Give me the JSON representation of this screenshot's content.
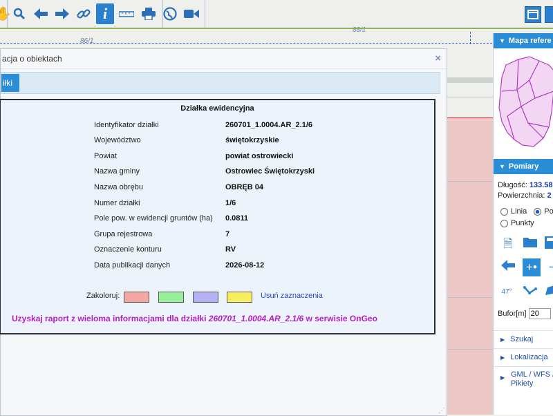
{
  "map": {
    "labels": [
      "86/1",
      "88/1"
    ]
  },
  "toolbar": {
    "icons": [
      "pan-icon",
      "zoom-icon",
      "back-icon",
      "forward-icon",
      "link-icon",
      "info-icon",
      "measure-icon",
      "print-icon",
      "globe-icon",
      "camera-icon"
    ],
    "info_glyph": "i"
  },
  "dialog": {
    "title": "acja o obiektach",
    "close": "×",
    "tab_label": "iłki",
    "heading": "Działka ewidencyjna",
    "rows": [
      {
        "label": "Identyfikator działki",
        "value": "260701_1.0004.AR_2.1/6"
      },
      {
        "label": "Województwo",
        "value": "świętokrzyskie"
      },
      {
        "label": "Powiat",
        "value": "powiat ostrowiecki"
      },
      {
        "label": "Nazwa gminy",
        "value": "Ostrowiec Świętokrzyski"
      },
      {
        "label": "Nazwa obrębu",
        "value": "OBRĘB 04"
      },
      {
        "label": "Numer działki",
        "value": "1/6"
      },
      {
        "label": "Pole pow. w ewidencji gruntów (ha)",
        "value": "0.0811"
      },
      {
        "label": "Grupa rejestrowa",
        "value": "7"
      },
      {
        "label": "Oznaczenie konturu",
        "value": "RV"
      },
      {
        "label": "Data publikacji danych",
        "value": "2026-08-12"
      }
    ],
    "colorize_label": "Zakoloruj:",
    "swatches": [
      "#f4a8a4",
      "#98f09a",
      "#b7b0f4",
      "#f6ee5c"
    ],
    "clear_link": "Usuń zaznaczenia",
    "report_prefix": "Uzyskaj raport z wieloma informacjami dla działki ",
    "report_id": "260701_1.0004.AR_2.1/6",
    "report_suffix": " w serwisie OnGeo"
  },
  "panel": {
    "refmap_title": "Mapa refere",
    "measure_title": "Pomiary",
    "length_label": "Długość: ",
    "length_value": "133.58",
    "area_label": "Powierzchnia: ",
    "area_value": "2",
    "radio_line": "Linia",
    "radio_polygon": "Po",
    "radio_points": "Punkty",
    "bufor_label": "Bufor[m]",
    "bufor_value": "20",
    "links": [
      "Szukaj",
      "Lokalizacja",
      "GML / WFS /",
      "Pikiety"
    ]
  }
}
